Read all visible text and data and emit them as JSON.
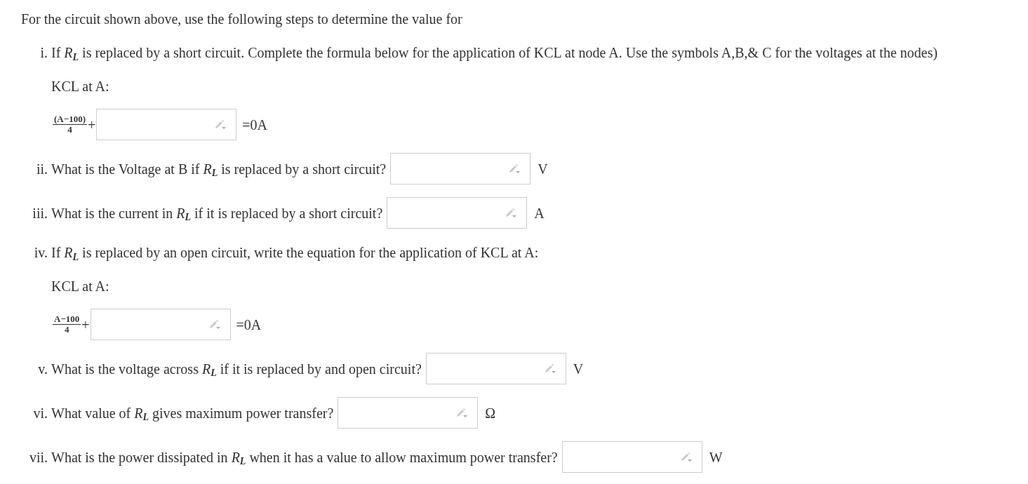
{
  "intro": "For the circuit shown above, use the following steps to determine the value for",
  "parts": [
    {
      "kind": "text",
      "marker": "i.",
      "text": "If *R*$_{L}$ is replaced by a short circuit. Complete the formula below for the application of KCL at node A. Use the symbols A,B,& C for the voltages at the nodes)"
    },
    {
      "kind": "label",
      "text": "KCL at A:"
    },
    {
      "kind": "formula",
      "numerator": "(A−100)",
      "denominator": "4",
      "operator": "+",
      "suffix": "=0A"
    },
    {
      "kind": "answer",
      "marker": "ii.",
      "text": "What is the Voltage at B if *R*$_{L}$ is replaced by a short circuit?",
      "unit": "V"
    },
    {
      "kind": "answer",
      "marker": "iii.",
      "text": "What is the current in *R*$_{L}$ if it is replaced by a short circuit?",
      "unit": "A"
    },
    {
      "kind": "text",
      "marker": "iv.",
      "text": "If *R*$_{L}$ is replaced by an open circuit, write the equation for the application of KCL at A:"
    },
    {
      "kind": "label",
      "text": "KCL at A:"
    },
    {
      "kind": "formula",
      "numerator": "A−100",
      "denominator": "4",
      "operator": "+",
      "suffix": "=0A"
    },
    {
      "kind": "answer",
      "marker": "v.",
      "text": "What is the voltage across *R*$_{L}$ if it is replaced by and open circuit?",
      "unit": "V"
    },
    {
      "kind": "answer",
      "marker": "vi.",
      "text": "What value of *R*$_{L}$ gives maximum power transfer?",
      "unit": "Ω"
    },
    {
      "kind": "answer",
      "marker": "vii.",
      "text": "What is the power dissipated in *R*$_{L}$ when it has a value to allow maximum power transfer?",
      "unit": "W"
    }
  ]
}
